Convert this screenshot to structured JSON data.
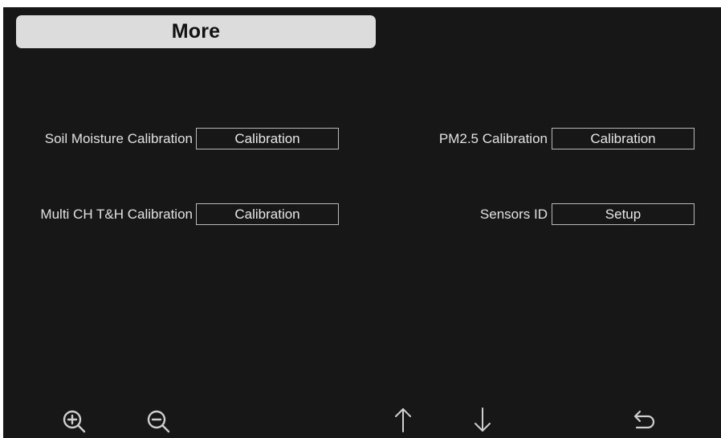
{
  "header": {
    "title": "More"
  },
  "settings": {
    "soil_moisture": {
      "label": "Soil Moisture Calibration",
      "button": "Calibration"
    },
    "pm25": {
      "label": "PM2.5 Calibration",
      "button": "Calibration"
    },
    "multi_ch": {
      "label": "Multi CH T&H Calibration",
      "button": "Calibration"
    },
    "sensors_id": {
      "label": "Sensors ID",
      "button": "Setup"
    }
  },
  "toolbar": {
    "icons": [
      "zoom-in-icon",
      "zoom-out-icon",
      "arrow-up-icon",
      "arrow-down-icon",
      "back-icon"
    ]
  },
  "colors": {
    "background": "#171717",
    "title_bar": "#dcdcdc",
    "text": "#e2e2e2",
    "border": "#b9b9b9"
  }
}
